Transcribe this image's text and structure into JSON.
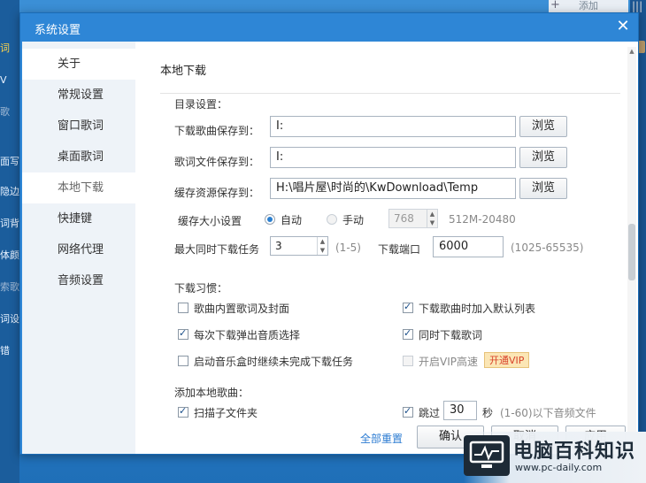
{
  "background": {
    "left_fragments": [
      "词",
      "V",
      "歌",
      "面写",
      "隐边",
      "词背",
      "体颜",
      "索歌",
      "词设",
      "错"
    ],
    "top_add": "添加"
  },
  "dialog": {
    "title": "系统设置",
    "close_icon": "close-icon"
  },
  "sidebar": {
    "items": [
      {
        "label": "关于"
      },
      {
        "label": "常规设置"
      },
      {
        "label": "窗口歌词"
      },
      {
        "label": "桌面歌词"
      },
      {
        "label": "本地下载"
      },
      {
        "label": "快捷键"
      },
      {
        "label": "网络代理"
      },
      {
        "label": "音频设置"
      }
    ],
    "active_index": 4
  },
  "content": {
    "section_title": "本地下载",
    "dir_settings": {
      "heading": "目录设置：",
      "song_label": "下载歌曲保存到：",
      "song_value": "I:",
      "lyric_label": "歌词文件保存到：",
      "lyric_value": "I:",
      "cache_label": "缓存资源保存到：",
      "cache_value": "H:\\唱片屋\\时尚的\\KwDownload\\Temp",
      "browse_label": "浏览"
    },
    "cache_size": {
      "label": "缓存大小设置",
      "auto_label": "自动",
      "manual_label": "手动",
      "value": "768",
      "range": "512M-20480",
      "selected": "auto"
    },
    "max_tasks": {
      "label": "最大同时下载任务",
      "value": "3",
      "range": "(1-5)",
      "port_label": "下载端口",
      "port_value": "6000",
      "port_range": "(1025-65535)"
    },
    "habits": {
      "heading": "下载习惯：",
      "items": [
        {
          "label": "歌曲内置歌词及封面",
          "checked": false,
          "disabled": false
        },
        {
          "label": "下载歌曲时加入默认列表",
          "checked": true,
          "disabled": false
        },
        {
          "label": "每次下载弹出音质选择",
          "checked": true,
          "disabled": false
        },
        {
          "label": "同时下载歌词",
          "checked": true,
          "disabled": false
        },
        {
          "label": "启动音乐盒时继续未完成下载任务",
          "checked": false,
          "disabled": false
        },
        {
          "label": "开启VIP高速",
          "checked": false,
          "disabled": true
        }
      ],
      "vip_badge": "开通VIP"
    },
    "add_local": {
      "heading": "添加本地歌曲：",
      "scan_label": "扫描子文件夹",
      "scan_checked": true,
      "skip_label": "跳过",
      "skip_checked": true,
      "skip_value": "30",
      "sec_label": "秒",
      "skip_range": "(1-60)以下音频文件"
    },
    "footer": {
      "reset_label": "全部重置",
      "ok_label": "确认",
      "cancel_label": "取消",
      "apply_label": "应用"
    }
  },
  "watermark": {
    "title": "电脑百科知识",
    "url": "www.pc-daily.com"
  }
}
